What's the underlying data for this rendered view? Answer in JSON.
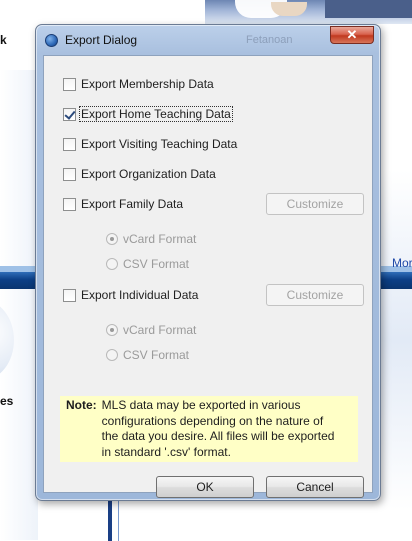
{
  "background": {
    "left_text_top": "k",
    "left_text_bottom": "es",
    "right_link": "Mor"
  },
  "dialog": {
    "title": "Export Dialog",
    "title_ghost": "Fetanoan",
    "close_glyph": "✕",
    "options": [
      {
        "label": "Export Membership Data",
        "checked": false
      },
      {
        "label": "Export Home Teaching Data",
        "checked": true
      },
      {
        "label": "Export Visiting Teaching Data",
        "checked": false
      },
      {
        "label": "Export Organization Data",
        "checked": false
      },
      {
        "label": "Export Family Data",
        "checked": false
      },
      {
        "label": "Export Individual Data",
        "checked": false
      }
    ],
    "customize_label": "Customize",
    "family_formats": [
      {
        "label": "vCard Format",
        "selected": true
      },
      {
        "label": "CSV Format",
        "selected": false
      }
    ],
    "individual_formats": [
      {
        "label": "vCard Format",
        "selected": true
      },
      {
        "label": "CSV Format",
        "selected": false
      }
    ],
    "note_label": "Note:",
    "note_text": "MLS data may be exported in various configurations depending on the nature of the data you desire.  All files will be exported in standard '.csv' format.",
    "ok_label": "OK",
    "cancel_label": "Cancel"
  }
}
